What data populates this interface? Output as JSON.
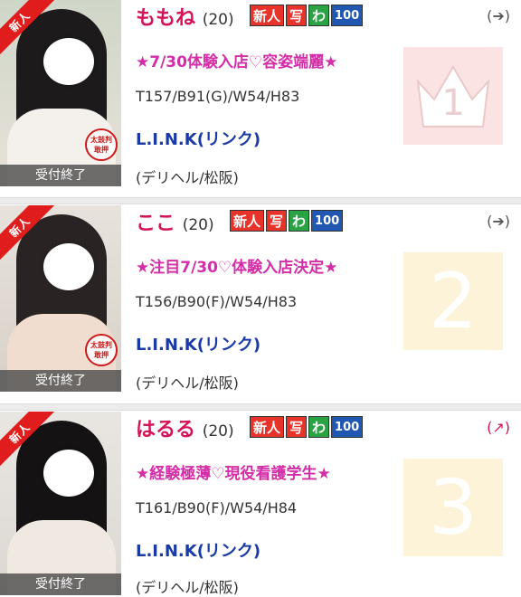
{
  "listings": [
    {
      "name": "ももね",
      "age": "(20)",
      "badges": {
        "new": "新人",
        "photo": "写",
        "wa": "わ",
        "score": "100"
      },
      "catch": "★7/30体験入店♡容姿端麗★",
      "spec": "T157/B91(G)/W54/H83",
      "shop": "L.I.N.K(リンク)",
      "area": "(デリヘル/松阪)",
      "status": "受付終了",
      "ribbon": "新人",
      "stamp": "太鼓判\n敢押",
      "rank": "1",
      "arrow": "(➔)"
    },
    {
      "name": "ここ",
      "age": "(20)",
      "badges": {
        "new": "新人",
        "photo": "写",
        "wa": "わ",
        "score": "100"
      },
      "catch": "★注目7/30♡体験入店決定★",
      "spec": "T156/B90(F)/W54/H83",
      "shop": "L.I.N.K(リンク)",
      "area": "(デリヘル/松阪)",
      "status": "受付終了",
      "ribbon": "新人",
      "stamp": "太鼓判\n敢押",
      "rank": "2",
      "arrow": "(➔)"
    },
    {
      "name": "はるる",
      "age": "(20)",
      "badges": {
        "new": "新人",
        "photo": "写",
        "wa": "わ",
        "score": "100"
      },
      "catch": "★経験極薄♡現役看護学生★",
      "spec": "T161/B90(F)/W54/H84",
      "shop": "L.I.N.K(リンク)",
      "area": "(デリヘル/松阪)",
      "status": "受付終了",
      "ribbon": "新人",
      "rank": "3",
      "arrow": "(↗)"
    }
  ],
  "colors": {
    "name": "#d4145a",
    "catch": "#d42da8",
    "shop": "#1a3aa5",
    "ribbon": "#e01c1c"
  }
}
